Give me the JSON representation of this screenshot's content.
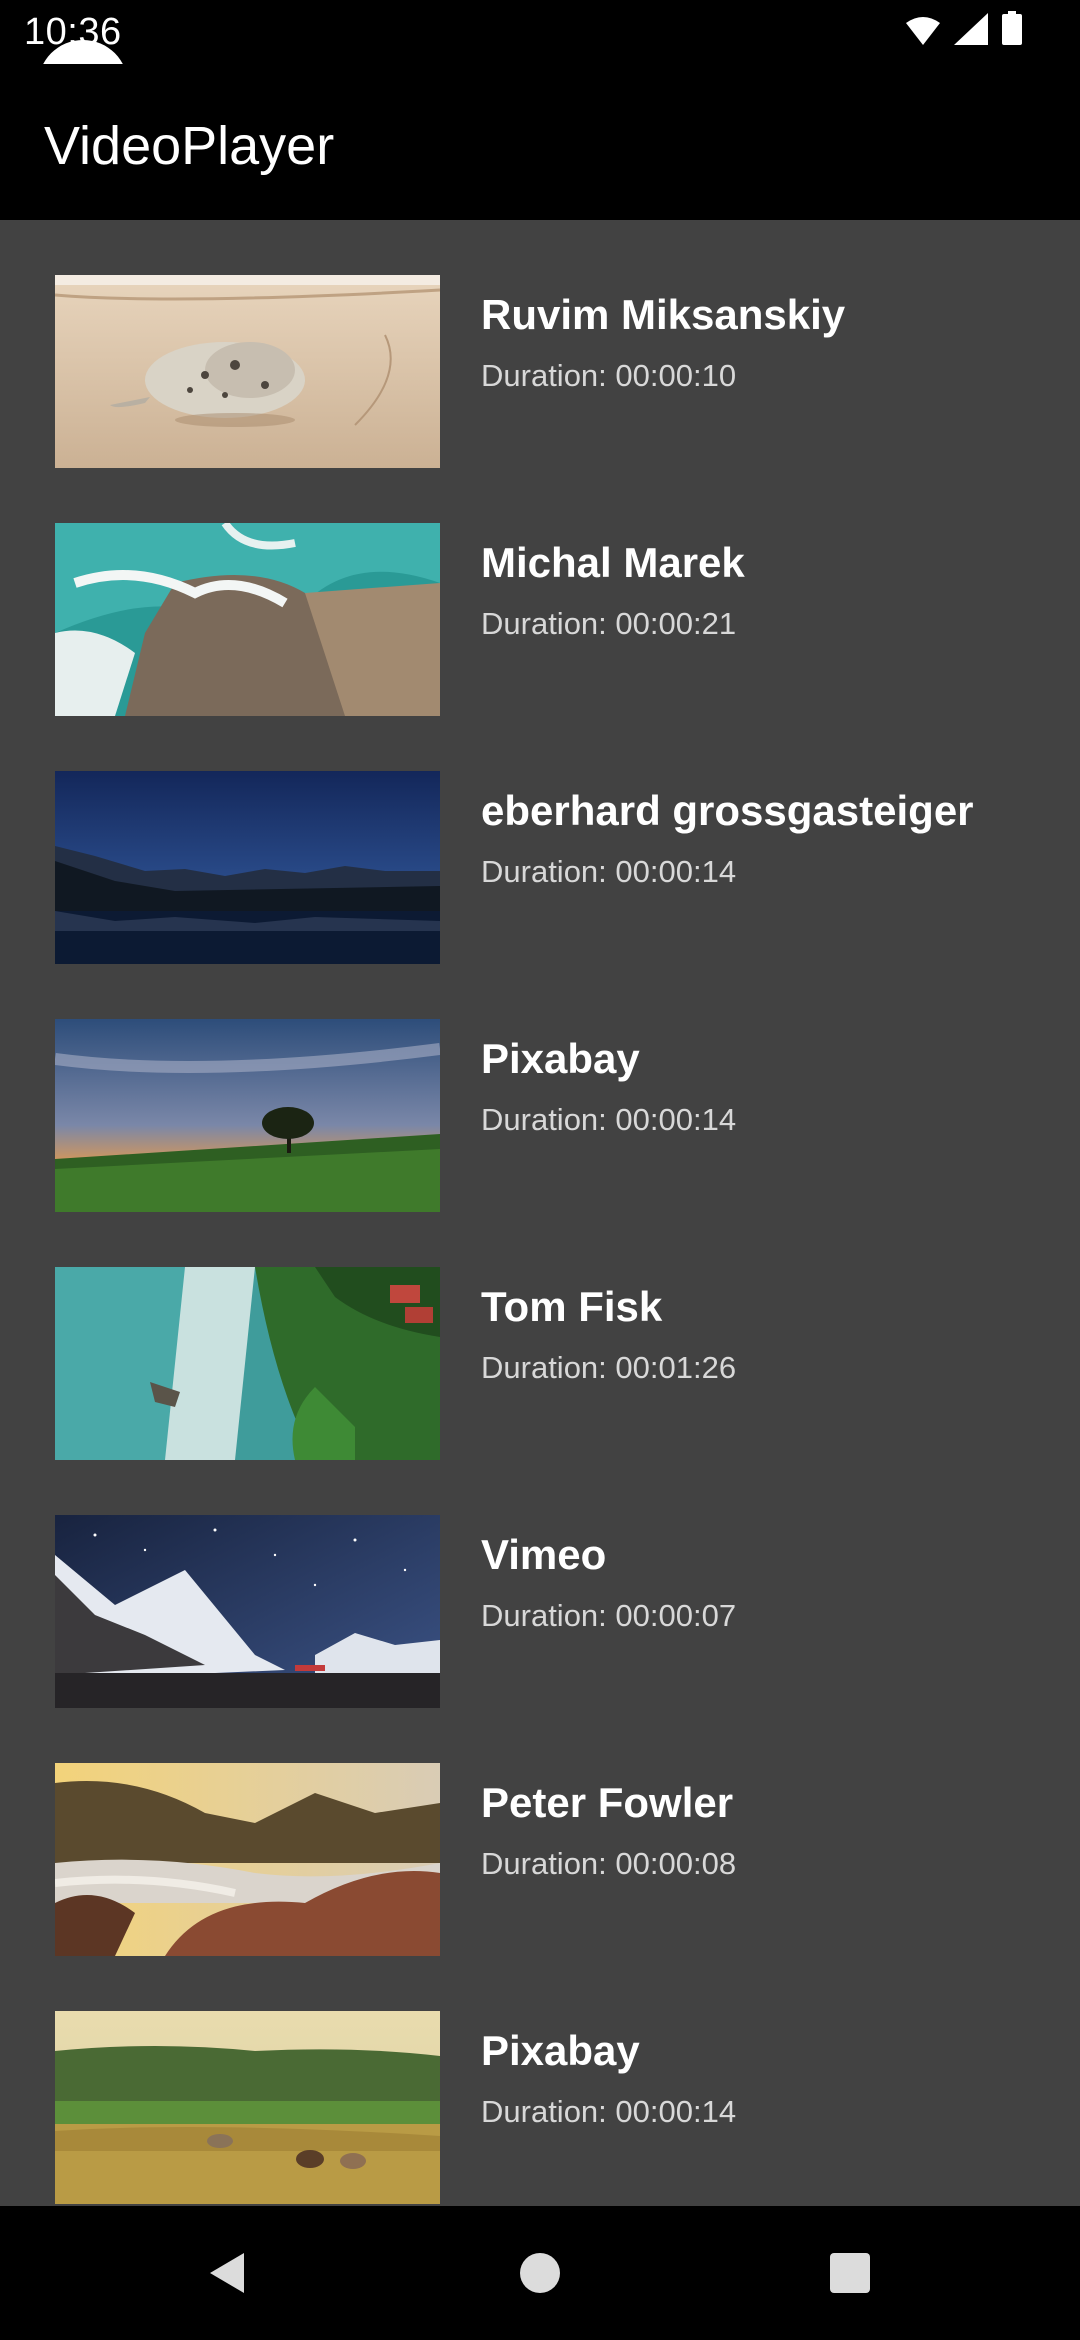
{
  "status_bar": {
    "time": "10:36",
    "icons": [
      "wifi-icon",
      "cell-signal-icon",
      "battery-icon"
    ]
  },
  "app_bar": {
    "title": "VideoPlayer"
  },
  "videos": [
    {
      "title": "Ruvim Miksanskiy",
      "duration": "Duration: 00:00:10",
      "thumbnail": "seal-on-beach"
    },
    {
      "title": "Michal Marek",
      "duration": "Duration: 00:00:21",
      "thumbnail": "aerial-waves-on-rocks"
    },
    {
      "title": "eberhard grossgasteiger",
      "duration": "Duration: 00:00:14",
      "thumbnail": "mountain-lake-reflection"
    },
    {
      "title": "Pixabay",
      "duration": "Duration: 00:00:14",
      "thumbnail": "sunset-tree-on-hill"
    },
    {
      "title": "Tom Fisk",
      "duration": "Duration: 00:01:26",
      "thumbnail": "aerial-coastline-forest"
    },
    {
      "title": "Vimeo",
      "duration": "Duration: 00:00:07",
      "thumbnail": "starry-mountain-night"
    },
    {
      "title": "Peter Fowler",
      "duration": "Duration: 00:00:08",
      "thumbnail": "sunlit-rocky-shore"
    },
    {
      "title": "Pixabay",
      "duration": "Duration: 00:00:14",
      "thumbnail": "cows-in-meadow"
    }
  ],
  "nav_bar": {
    "buttons": [
      "back-icon",
      "home-icon",
      "recents-icon"
    ]
  },
  "colors": {
    "app_bar": "#000000",
    "list_background": "#424242",
    "title_text": "#ffffff",
    "duration_text": "#d8d8d8"
  }
}
